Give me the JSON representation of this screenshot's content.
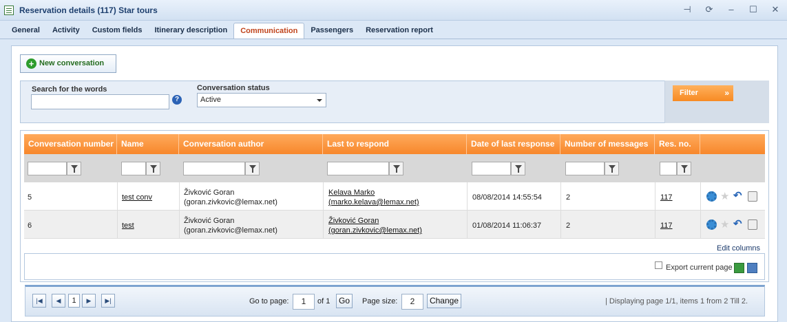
{
  "window": {
    "title": "Reservation details (117) Star tours"
  },
  "tabs": [
    {
      "label": "General"
    },
    {
      "label": "Activity"
    },
    {
      "label": "Custom fields"
    },
    {
      "label": "Itinerary description"
    },
    {
      "label": "Communication",
      "active": true
    },
    {
      "label": "Passengers"
    },
    {
      "label": "Reservation report"
    }
  ],
  "toolbar": {
    "new_conversation_label": "New conversation"
  },
  "search": {
    "words_label": "Search for the words",
    "words_value": "",
    "status_label": "Conversation status",
    "status_value": "Active",
    "filter_label": "Filter"
  },
  "grid": {
    "columns": [
      "Conversation number",
      "Name",
      "Conversation author",
      "Last to respond",
      "Date of last response",
      "Number of messages",
      "Res. no."
    ],
    "rows": [
      {
        "number": "5",
        "name": "test conv",
        "author_name": "Živković Goran",
        "author_email": "(goran.zivkovic@lemax.net)",
        "last_name": "Kelava Marko",
        "last_email": "(marko.kelava@lemax.net)",
        "date": "08/08/2014 14:55:54",
        "messages": "2",
        "res_no": "117"
      },
      {
        "number": "6",
        "name": "test",
        "author_name": "Živković Goran",
        "author_email": "(goran.zivkovic@lemax.net)",
        "last_name": "Živković Goran",
        "last_email": "(goran.zivkovic@lemax.net)",
        "date": "01/08/2014 11:06:37",
        "messages": "2",
        "res_no": "117"
      }
    ],
    "edit_columns_label": "Edit columns",
    "export_label": "Export current page"
  },
  "pager": {
    "current_page": "1",
    "go_to_label": "Go to page:",
    "go_to_value": "1",
    "of_label": "of 1",
    "go_button": "Go",
    "page_size_label": "Page size:",
    "page_size_value": "2",
    "change_button": "Change",
    "info": "| Displaying page  1/1,  items  1  from  2  Till  2."
  },
  "colors": {
    "header_orange": "#f7872b",
    "active_tab": "#c0441c",
    "new_button_green": "#2d9c2d"
  }
}
